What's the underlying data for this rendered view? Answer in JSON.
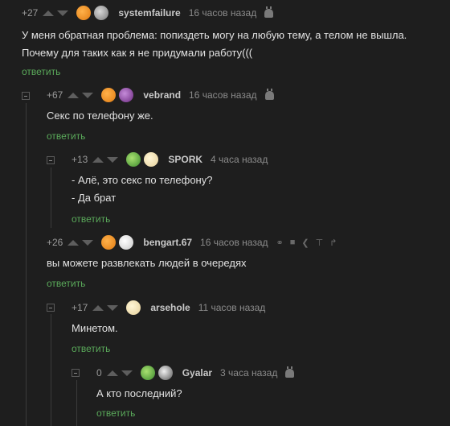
{
  "comments": [
    {
      "rating": "+27",
      "user": "systemfailure",
      "time": "16 часов назад",
      "lines": [
        "У меня обратная проблема: попиздеть могу на любую тему, а телом не вышла.",
        "Почему для таких как я не придумали работу((("
      ],
      "reply": "ответить"
    },
    {
      "rating": "+67",
      "user": "vebrand",
      "time": "16 часов назад",
      "lines": [
        "Секс по телефону же."
      ],
      "reply": "ответить"
    },
    {
      "rating": "+13",
      "user": "SPORK",
      "time": "4 часа назад",
      "lines": [
        "- Алё, это секс по телефону?",
        "- Да брат"
      ],
      "reply": "ответить"
    },
    {
      "rating": "+26",
      "user": "bengart.67",
      "time": "16 часов назад",
      "lines": [
        "вы можете развлекать людей в очередях"
      ],
      "reply": "ответить"
    },
    {
      "rating": "+17",
      "user": "arsehole",
      "time": "11 часов назад",
      "lines": [
        "Минетом."
      ],
      "reply": "ответить"
    },
    {
      "rating": "0",
      "user": "Gyalar",
      "time": "3 часа назад",
      "lines": [
        "А кто последний?"
      ],
      "reply": "ответить"
    }
  ],
  "icons": {
    "upvote": "arrow-up-icon",
    "downvote": "arrow-down-icon",
    "device": "android-icon",
    "link": "link-icon",
    "save": "save-icon",
    "share": "share-icon",
    "top": "arrow-top-icon",
    "branch": "branch-icon"
  },
  "colors": {
    "background": "#1e1e1e",
    "reply": "#5aa95a"
  }
}
